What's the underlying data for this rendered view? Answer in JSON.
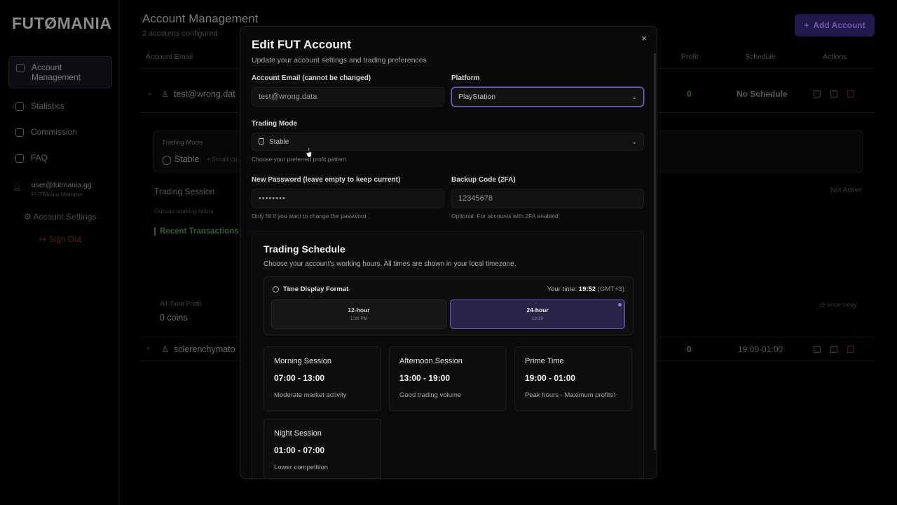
{
  "app": {
    "logo": "FUTØMANIA"
  },
  "sidebar": {
    "items": [
      {
        "label": "Account Management",
        "icon": "wallet-icon"
      },
      {
        "label": "Statistics",
        "icon": "trending-up-icon"
      },
      {
        "label": "Commission",
        "icon": "percent-icon"
      },
      {
        "label": "FAQ",
        "icon": "help-icon"
      }
    ],
    "user_email": "user@futmania.gg",
    "user_role": "FUTMania Member",
    "account_settings": "Account Settings",
    "sign_out": "Sign Out"
  },
  "page": {
    "title": "Account Management",
    "subtitle": "2 accounts configured",
    "add_account": "Add Account"
  },
  "table": {
    "headers": {
      "email": "Account Email",
      "profit": "Profit",
      "schedule": "Schedule",
      "actions": "Actions"
    },
    "rows": [
      {
        "email": "test@wrong.dat",
        "profit": "0",
        "schedule": "No Schedule"
      },
      {
        "email": "sclerenchymato",
        "profit": "0",
        "schedule": "19:00-01:00"
      }
    ],
    "detail": {
      "trading_mode_label": "Trading Mode",
      "trading_mode_value": "Stable",
      "trading_mode_note": "• Small co",
      "trading_session": "Trading Session",
      "session_status": "Not Active",
      "outside_hours": "Outside working hours",
      "recent_transactions": "Recent Transactions",
      "all_time_profit_label": "All-Time Profit",
      "all_time_profit_value": "0 coins",
      "since": "since today"
    }
  },
  "modal": {
    "title": "Edit FUT Account",
    "description": "Update your account settings and trading preferences",
    "close": "×",
    "email_label": "Account Email (cannot be changed)",
    "email_value": "test@wrong.data",
    "platform_label": "Platform",
    "platform_value": "PlayStation",
    "mode_label": "Trading Mode",
    "mode_value": "Stable",
    "mode_help": "Choose your preferred profit pattern",
    "password_label": "New Password (leave empty to keep current)",
    "password_value": "••••••••",
    "password_help": "Only fill if you want to change the password",
    "backup_label": "Backup Code (2FA)",
    "backup_value": "12345678",
    "backup_help": "Optional: For accounts with 2FA enabled",
    "schedule": {
      "title": "Trading Schedule",
      "description": "Choose your account's working hours. All times are shown in your local timezone.",
      "format_title": "Time Display Format",
      "your_time_label": "Your time:",
      "your_time_value": "19:52",
      "timezone": "(GMT+3)",
      "formats": [
        {
          "name": "12-hour",
          "example": "1:30 PM",
          "selected": false
        },
        {
          "name": "24-hour",
          "example": "13:30",
          "selected": true
        }
      ],
      "sessions": [
        {
          "name": "Morning Session",
          "time": "07:00 - 13:00",
          "desc": "Moderate market activity"
        },
        {
          "name": "Afternoon Session",
          "time": "13:00 - 19:00",
          "desc": "Good trading volume"
        },
        {
          "name": "Prime Time",
          "time": "19:00 - 01:00",
          "desc": "Peak hours - Maximum profits!"
        },
        {
          "name": "Night Session",
          "time": "01:00 - 07:00",
          "desc": "Lower competition"
        }
      ]
    }
  },
  "colors": {
    "accent": "#7a6ac8",
    "background": "#000000",
    "modal": "#0a0a0a"
  }
}
